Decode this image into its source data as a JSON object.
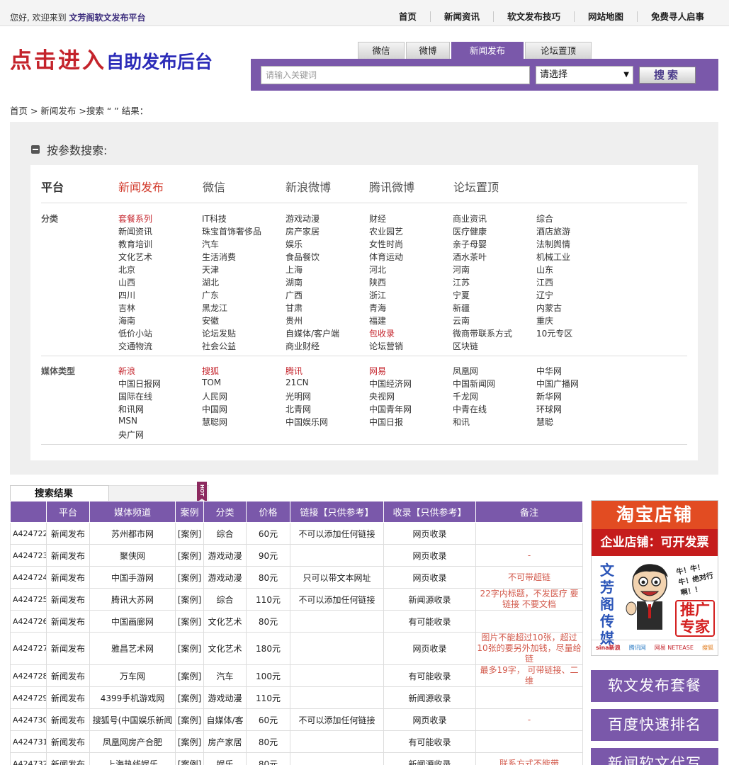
{
  "topbar": {
    "welcome_prefix": "您好, 欢迎来到",
    "site_name": "文芳阁软文发布平台",
    "nav": [
      "首页",
      "新闻资讯",
      "软文发布技巧",
      "网站地图",
      "免费寻人启事"
    ]
  },
  "logo": {
    "part1": "点击进入",
    "part2": "自助发布后台"
  },
  "search": {
    "tabs": [
      "微信",
      "微博",
      "新闻发布",
      "论坛置顶"
    ],
    "active_tab": "新闻发布",
    "placeholder": "请输入关键词",
    "select_value": "请选择",
    "button": "搜索"
  },
  "breadcrumb": "首页 > 新闻发布 >搜索 “ ” 结果：",
  "filter": {
    "heading": "按参数搜索:",
    "platform_label": "平台",
    "platforms": [
      "新闻发布",
      "微信",
      "新浪微博",
      "腾讯微博",
      "论坛置顶"
    ],
    "category_label": "分类",
    "categories": [
      [
        "套餐系列",
        "IT科技",
        "游戏动漫",
        "财经",
        "商业资讯",
        "综合"
      ],
      [
        "新闻资讯",
        "珠宝首饰奢侈品",
        "房产家居",
        "农业园艺",
        "医疗健康",
        "酒店旅游"
      ],
      [
        "教育培训",
        "汽车",
        "娱乐",
        "女性时尚",
        "亲子母婴",
        "法制舆情"
      ],
      [
        "文化艺术",
        "生活消费",
        "食品餐饮",
        "体育运动",
        "酒水茶叶",
        "机械工业"
      ],
      [
        "北京",
        "天津",
        "上海",
        "河北",
        "河南",
        "山东"
      ],
      [
        "山西",
        "湖北",
        "湖南",
        "陕西",
        "江苏",
        "江西"
      ],
      [
        "四川",
        "广东",
        "广西",
        "浙江",
        "宁夏",
        "辽宁"
      ],
      [
        "吉林",
        "黑龙江",
        "甘肃",
        "青海",
        "新疆",
        "内蒙古"
      ],
      [
        "海南",
        "安徽",
        "贵州",
        "福建",
        "云南",
        "重庆"
      ],
      [
        "低价小站",
        "论坛发贴",
        "自媒体/客户端",
        "包收录",
        "微商带联系方式",
        "10元专区"
      ],
      [
        "交通物流",
        "社会公益",
        "商业财经",
        "论坛营销",
        "区块链",
        ""
      ]
    ],
    "category_highlights": [
      "套餐系列",
      "包收录"
    ],
    "media_label": "媒体类型",
    "media": [
      [
        "新浪",
        "搜狐",
        "腾讯",
        "网易",
        "凤凰网",
        "中华网"
      ],
      [
        "中国日报网",
        "TOM",
        "21CN",
        "中国经济网",
        "中国新闻网",
        "中国广播网"
      ],
      [
        "国际在线",
        "人民网",
        "光明网",
        "央视网",
        "千龙网",
        "新华网"
      ],
      [
        "和讯网",
        "中国网",
        "北青网",
        "中国青年网",
        "中青在线",
        "环球网"
      ],
      [
        "MSN",
        "慧聪网",
        "中国娱乐网",
        "中国日报",
        "和讯",
        "慧聪"
      ],
      [
        "央广网",
        "",
        "",
        "",
        "",
        ""
      ]
    ],
    "media_highlights": [
      "新浪",
      "搜狐",
      "腾讯",
      "网易"
    ]
  },
  "results": {
    "tab_label": "搜索结果",
    "hot_badge": "HOT",
    "headers": [
      "",
      "平台",
      "媒体频道",
      "案例",
      "分类",
      "价格",
      "链接【只供参考】",
      "收录【只供参考】",
      "备注"
    ],
    "rows": [
      [
        "A424722",
        "新闻发布",
        "苏州都市网",
        "[案例]",
        "综合",
        "60元",
        "不可以添加任何链接",
        "网页收录",
        ""
      ],
      [
        "A424723",
        "新闻发布",
        "聚侠网",
        "[案例]",
        "游戏动漫",
        "90元",
        "",
        "网页收录",
        "-"
      ],
      [
        "A424724",
        "新闻发布",
        "中国手游网",
        "[案例]",
        "游戏动漫",
        "80元",
        "只可以带文本网址",
        "网页收录",
        "不可带超链"
      ],
      [
        "A424725",
        "新闻发布",
        "腾讯大苏网",
        "[案例]",
        "综合",
        "110元",
        "不可以添加任何链接",
        "新闻源收录",
        "22字内标题，不发医疗 要链接 不要文档"
      ],
      [
        "A424726",
        "新闻发布",
        "中国画廊网",
        "[案例]",
        "文化艺术",
        "80元",
        "",
        "有可能收录",
        ""
      ],
      [
        "A424727",
        "新闻发布",
        "雅昌艺术网",
        "[案例]",
        "文化艺术",
        "180元",
        "",
        "网页收录",
        "图片不能超过10张，超过10张的要另外加钱，尽量给链"
      ],
      [
        "A424728",
        "新闻发布",
        "万车网",
        "[案例]",
        "汽车",
        "100元",
        "",
        "有可能收录",
        "最多19字， 可带链接、二维"
      ],
      [
        "A424729",
        "新闻发布",
        "4399手机游戏网",
        "[案例]",
        "游戏动漫",
        "110元",
        "",
        "新闻源收录",
        ""
      ],
      [
        "A424730",
        "新闻发布",
        "搜狐号(中国娱乐新闻",
        "[案例]",
        "自媒体/客",
        "60元",
        "不可以添加任何链接",
        "网页收录",
        "-"
      ],
      [
        "A424731",
        "新闻发布",
        "凤凰网房产合肥",
        "[案例]",
        "房产家居",
        "80元",
        "",
        "有可能收录",
        ""
      ],
      [
        "A424732",
        "新闻发布",
        "上海热线娱乐",
        "[案例]",
        "娱乐",
        "80元",
        "",
        "新闻源收录",
        "联系方式不能带"
      ]
    ]
  },
  "side": {
    "taobao_title": "淘宝店铺",
    "taobao_sub": "企业店铺：可开发票",
    "taobao_brand": "文芳阁传媒",
    "taobao_tag": "推广专家",
    "bubble": "牛！牛！牛！绝对行啊！！",
    "logos": [
      "sina新浪",
      "腾讯网",
      "网易 NETEASE",
      "搜狐"
    ],
    "buttons": [
      "软文发布套餐",
      "百度快速排名",
      "新闻软文代写"
    ]
  }
}
